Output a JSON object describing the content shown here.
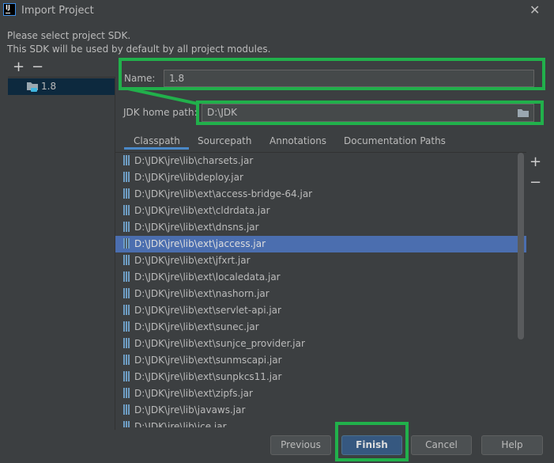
{
  "window": {
    "title": "Import Project",
    "logo": "IJ",
    "close": "✕"
  },
  "description": [
    "Please select project SDK.",
    "This SDK will be used by default by all project modules."
  ],
  "sdk_toolbar": {
    "add": "+",
    "remove": "−"
  },
  "sdks": [
    {
      "name": "1.8",
      "icon": "jdk-folder-icon"
    }
  ],
  "form": {
    "name_label": "Name:",
    "name_value": "1.8",
    "home_label": "JDK home path:",
    "home_value": "D:\\JDK"
  },
  "tabs": [
    {
      "label": "Classpath",
      "active": true
    },
    {
      "label": "Sourcepath"
    },
    {
      "label": "Annotations"
    },
    {
      "label": "Documentation Paths"
    }
  ],
  "classpath": [
    "D:\\JDK\\jre\\lib\\charsets.jar",
    "D:\\JDK\\jre\\lib\\deploy.jar",
    "D:\\JDK\\jre\\lib\\ext\\access-bridge-64.jar",
    "D:\\JDK\\jre\\lib\\ext\\cldrdata.jar",
    "D:\\JDK\\jre\\lib\\ext\\dnsns.jar",
    "D:\\JDK\\jre\\lib\\ext\\jaccess.jar",
    "D:\\JDK\\jre\\lib\\ext\\jfxrt.jar",
    "D:\\JDK\\jre\\lib\\ext\\localedata.jar",
    "D:\\JDK\\jre\\lib\\ext\\nashorn.jar",
    "D:\\JDK\\jre\\lib\\ext\\servlet-api.jar",
    "D:\\JDK\\jre\\lib\\ext\\sunec.jar",
    "D:\\JDK\\jre\\lib\\ext\\sunjce_provider.jar",
    "D:\\JDK\\jre\\lib\\ext\\sunmscapi.jar",
    "D:\\JDK\\jre\\lib\\ext\\sunpkcs11.jar",
    "D:\\JDK\\jre\\lib\\ext\\zipfs.jar",
    "D:\\JDK\\jre\\lib\\javaws.jar",
    "D:\\JDK\\jre\\lib\\jce.jar"
  ],
  "selected_index": 5,
  "list_actions": {
    "add": "+",
    "remove": "−"
  },
  "buttons": {
    "previous": "Previous",
    "finish": "Finish",
    "cancel": "Cancel",
    "help": "Help"
  },
  "colors": {
    "highlight": "#21b04b",
    "selection": "#4b6eaf",
    "primary_button": "#365880"
  }
}
